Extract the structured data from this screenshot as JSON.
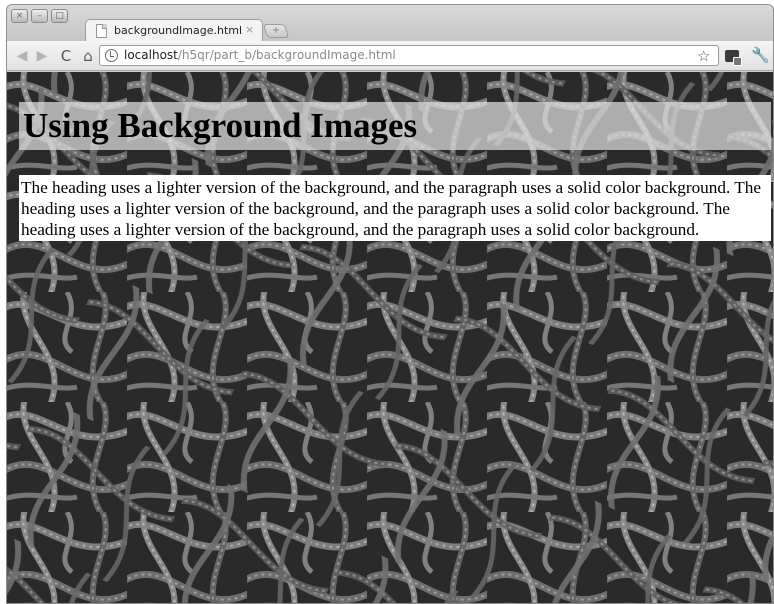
{
  "window": {
    "controls": [
      "×",
      "–",
      "□"
    ]
  },
  "tab": {
    "title": "backgroundImage.html",
    "close_label": "×"
  },
  "newtab_label": "+",
  "address_bar": {
    "host": "localhost",
    "path": "/h5qr/part_b/backgroundImage.html"
  },
  "toolbar_icons": {
    "back": "◀",
    "forward": "▶",
    "reload": "C",
    "home": "⌂",
    "bookmark": "☆",
    "wrench": "🔧"
  },
  "page": {
    "heading": "Using Background Images",
    "paragraph": "The heading uses a lighter version of the background, and the paragraph uses a solid color background. The heading uses a lighter version of the background, and the paragraph uses a solid color background. The heading uses a lighter version of the background, and the paragraph uses a solid color background."
  }
}
